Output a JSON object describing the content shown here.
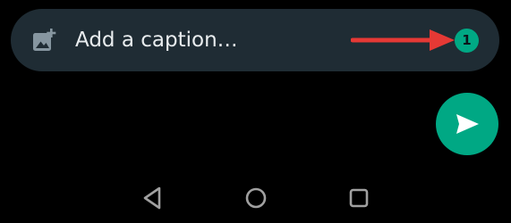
{
  "caption": {
    "placeholder": "Add a caption…",
    "value": ""
  },
  "badge": {
    "count": "1"
  },
  "icons": {
    "gallery": "add-photo-icon",
    "send": "send-icon",
    "back": "nav-back-icon",
    "home": "nav-home-icon",
    "recents": "nav-recents-icon"
  },
  "colors": {
    "background": "#000000",
    "input_bar": "#1f2c34",
    "accent": "#00a884",
    "annotation": "#e53935",
    "text": "#e9edef",
    "nav_icons": "#a0a0a0"
  }
}
